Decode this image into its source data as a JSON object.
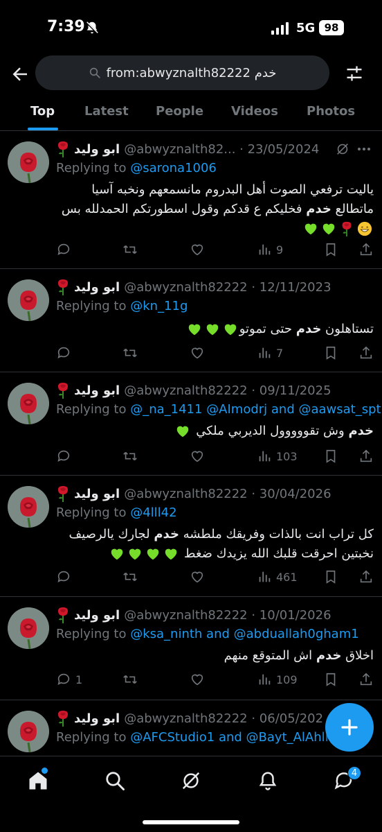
{
  "status": {
    "time": "7:39",
    "network": "5G",
    "battery": "98"
  },
  "search": {
    "query": "from:abwyznalth82222 خدم"
  },
  "tabs": [
    {
      "label": "Top",
      "active": true
    },
    {
      "label": "Latest",
      "active": false
    },
    {
      "label": "People",
      "active": false
    },
    {
      "label": "Videos",
      "active": false
    },
    {
      "label": "Photos",
      "active": false
    }
  ],
  "tweets": [
    {
      "name": "ابو وليد",
      "handle_date": "@abwyznalth82... · 23/05/2024",
      "replying_prefix": "Replying to ",
      "replying_to": "@sarona1006",
      "text_before": "ياليت ترفعي الصوت أهل البدروم مانسمعهم ونخبه آسيا ماتطالع ",
      "keyword": "خدم",
      "text_after": " فخليكم ع قدكم وقول اسطورتكم الحمدلله بس",
      "replies": "",
      "views": "9"
    },
    {
      "name": "ابو وليد",
      "handle_date": "@abwyznalth82222 · 12/11/2023",
      "replying_prefix": "Replying to ",
      "replying_to": "@kn_11g",
      "text_before": "تستاهلون ",
      "keyword": "خدم",
      "text_after": " حتى تموتو",
      "replies": "",
      "views": "7"
    },
    {
      "name": "ابو وليد",
      "handle_date": "@abwyznalth82222 · 09/11/2025",
      "replying_prefix": "Replying to ",
      "replying_to": "@_na_1411 @AImodrj and @aawsat_spt",
      "text_before": "",
      "keyword": "خدم",
      "text_after": " وش تقووووول الديربي ملكي",
      "replies": "",
      "views": "103"
    },
    {
      "name": "ابو وليد",
      "handle_date": "@abwyznalth82222 · 30/04/2026",
      "replying_prefix": "Replying to ",
      "replying_to": "@4lll42",
      "text_before": "كل تراب انت بالذات وفريقك ملطشه ",
      "keyword": "خدم",
      "text_after": " لجارك يالرصيف نخبتين احرقت قلبك الله يزيدك ضغط",
      "replies": "",
      "views": "461"
    },
    {
      "name": "ابو وليد",
      "handle_date": "@abwyznalth82222 · 10/01/2026",
      "replying_prefix": "Replying to ",
      "replying_to": "@ksa_ninth and @abduallah0gham1",
      "text_before": "اخلاق ",
      "keyword": "خدم",
      "text_after": " اش المتوقع منهم",
      "replies": "1",
      "views": "109"
    },
    {
      "name": "ابو وليد",
      "handle_date": "@abwyznalth82222 · 06/05/202",
      "replying_prefix": "Replying to ",
      "replying_to": "@AFCStudio1 and @Bayt_AlAhli",
      "text_before": "",
      "keyword": "",
      "text_after": "",
      "replies": "",
      "views": ""
    }
  ],
  "nav": {
    "messages_badge": "4"
  },
  "colors": {
    "accent": "#1d9bf0",
    "muted": "#71767b",
    "heart": "#77dd2b"
  }
}
